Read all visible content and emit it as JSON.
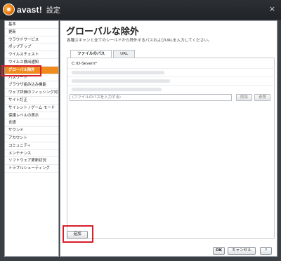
{
  "app": {
    "logo_text": "avast!",
    "title": "設定"
  },
  "window": {
    "close_glyph": "×"
  },
  "sidebar": {
    "items": [
      {
        "label": "基本"
      },
      {
        "label": "更新"
      },
      {
        "label": "ウラウドサービス"
      },
      {
        "label": "ポップアップ"
      },
      {
        "label": "ウイルスチェスト"
      },
      {
        "label": "ウイルス検出通知"
      },
      {
        "label": "グローバル除外"
      },
      {
        "label": "パスワード"
      },
      {
        "label": "ブラウザ組み込み機能"
      },
      {
        "label": "ウェブ評価のフィッシング対策"
      },
      {
        "label": "サイト訂正"
      },
      {
        "label": "サイレント / ゲーム モード"
      },
      {
        "label": "保護レベルの表示"
      },
      {
        "label": "言語"
      },
      {
        "label": "サウンド"
      },
      {
        "label": "アカウント"
      },
      {
        "label": "コミュニティ"
      },
      {
        "label": "メンテナンス"
      },
      {
        "label": "ソフトウェア更新状況"
      },
      {
        "label": "トラブルシューティング"
      }
    ],
    "active_index": 6
  },
  "main": {
    "heading": "グローバルな除外",
    "description": "各種スキャンと全てのシールドから除外するパスおよびURLを入力してください。",
    "tabs": [
      {
        "label": "ファイルのパス"
      },
      {
        "label": "URL"
      }
    ],
    "paths": [
      {
        "value": "C:\\O-Seven\\*"
      }
    ],
    "path_input": {
      "placeholder": "(ファイルのパスを入力する)"
    },
    "delete_label": "削除",
    "browse_label": "参照",
    "add_label": "追加"
  },
  "footer": {
    "ok_label": "OK",
    "cancel_label": "キャンセル",
    "help_label": "?"
  },
  "colors": {
    "accent": "#f08a1c",
    "highlight": "#d6202a",
    "titlebar": "#2c3034"
  }
}
